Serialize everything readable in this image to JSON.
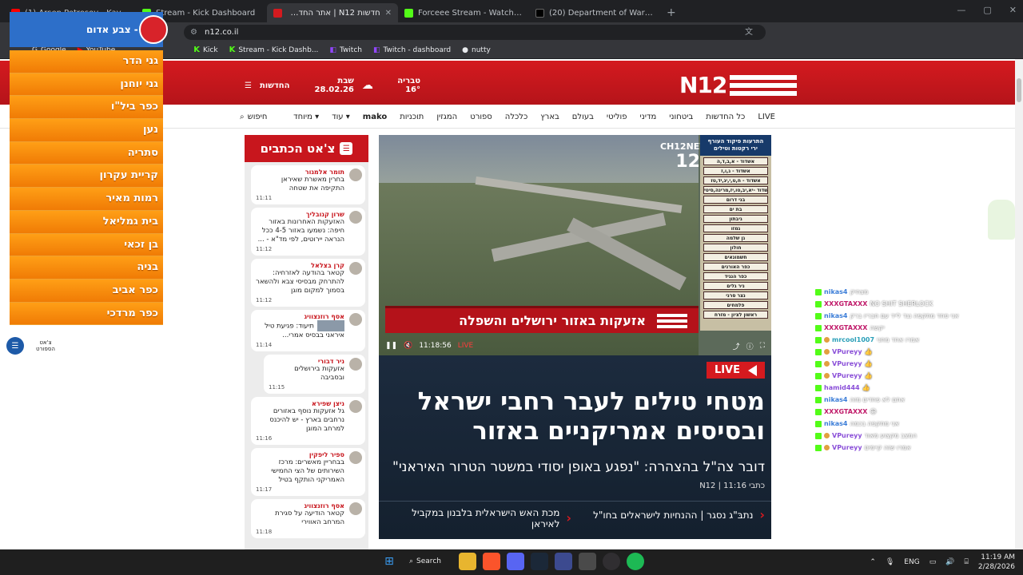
{
  "browser": {
    "tabs": [
      {
        "title": "(1) Arsen Petrosov - Kayfuem - YouTu",
        "color": "#ff0000",
        "active": false
      },
      {
        "title": "Stream - Kick Dashboard",
        "color": "#53fc18",
        "active": false
      },
      {
        "title": "חדשות N12 | אתר החדשות שו",
        "color": "#d41a1f",
        "active": true
      },
      {
        "title": "Forceee Stream - Watch Live on Kick",
        "color": "#53fc18",
        "active": false
      },
      {
        "title": "(20) Department of War us (@Deptof",
        "color": "#000000",
        "active": false
      }
    ],
    "url": "n12.co.il",
    "bookmarks": [
      {
        "label": "Google",
        "icon": "google-icon"
      },
      {
        "label": "YouTube",
        "icon": "youtube-icon"
      },
      {
        "label": "Kick",
        "icon": "kick-icon"
      },
      {
        "label": "Stream - Kick Dashb...",
        "icon": "kick-icon"
      },
      {
        "label": "Twitch",
        "icon": "twitch-icon"
      },
      {
        "label": "Twitch - dashboard",
        "icon": "twitch-icon"
      },
      {
        "label": "nutty",
        "icon": "nutty-icon"
      }
    ]
  },
  "n12": {
    "logo": "N12",
    "weather": "טבריה 16°",
    "date": "שבת 28.02.26",
    "news_link": "החדשות",
    "nav": [
      "LIVE",
      "כל החדשות",
      "ביטחוני",
      "מדיני",
      "פוליטי",
      "בעולם",
      "בארץ",
      "כלכלה",
      "ספורט",
      "המגזין",
      "תוכניות",
      "mako",
      "עוד",
      "מיוחד"
    ],
    "search_label": "חיפוש",
    "chat_title": "צ'אט הכתבים",
    "chat_messages": [
      {
        "author": "תומר אלמגור",
        "text": "בחרין מאשרת שאיראן התקיפה את שטחה",
        "time": "11:11"
      },
      {
        "author": "שרון קנובליך",
        "text": "האזעקות האחרונות באזור חיפה: נשמעו באזור 4-5 ככל הנראה יירוטים, לפי מד\"א - ...",
        "time": "11:12"
      },
      {
        "author": "קרן בצלאל",
        "text": "קטאר בהודעה לאזרחיה: להתרחק מבסיסי צבא ולהשאר בסמוך למקום מוגן",
        "time": "11:12"
      },
      {
        "author": "אסף רוזנצוויג",
        "text": "תיעוד: פגיעת טיל איראני בבסיס אמרי...",
        "time": "11:14"
      },
      {
        "author": "ניר דבורי",
        "text": "אזעקות בירושלים ובסביבה",
        "time": "11:15"
      },
      {
        "author": "ניצן שפירא",
        "text": "גל אזעקות נוסף באזורים נרחבים בארץ - יש להיכנס למרחב המוגן",
        "time": "11:16"
      },
      {
        "author": "ספיר ליפקין",
        "text": "בבחריין מאשרים: מרכז השירותים של הצי החמישי האמריקני הותקף בטיל",
        "time": "11:17"
      },
      {
        "author": "אסף רוזנצוויג",
        "text": "קטאר הודיעה על סגירת המרחב האווירי",
        "time": "11:18"
      }
    ],
    "video": {
      "channel": "CH12NEWS",
      "channel_num": "12",
      "banner": "אזעקות באזור ירושלים והשפלה",
      "timecode": "11:18:56",
      "live_label": "LIVE",
      "alerts_header": "התרעות פיקוד העורף",
      "alerts_sub": "ירי רקטות וטילים",
      "alerts": [
        "אשדוד - א,ב,ד,ה",
        "אשדוד - ג,ו,ז",
        "אשדוד - ח,ט,י,יג,יד,טז",
        "אשדוד -יא,יב,טו,יז,מרינה,סיטי",
        "בני דרום",
        "בת ים",
        "גיבתון",
        "גמזו",
        "גן שלמה",
        "חולון",
        "חשמונאים",
        "כפר האורנים",
        "כפר הנגיד",
        "ניר גלים",
        "נצר סרני",
        "פלמחים",
        "ראשון לציון - מזרח"
      ]
    },
    "headline": {
      "live_badge": "LIVE",
      "title": "מטחי טילים לעבר רחבי ישראל ובסיסים אמריקניים באזור",
      "subtitle": "דובר צה\"ל בהצהרה: \"נפגע באופן יסודי במשטר הטרור האיראני\"",
      "meta": "כתבי N12 | 11:16",
      "related": [
        "נתבּ\"ג נסגר | ההנחיות לישראלים בחו\"ל",
        "מכת האש הישראלית בלבנון במקביל לאיראן"
      ]
    }
  },
  "alert_widget": {
    "title": "צופר - צבע אדום",
    "towns": [
      "גני הדר",
      "גני יוחנן",
      "כפר ביל\"ו",
      "נען",
      "סתריה",
      "קריית עקרון",
      "רמות מאיר",
      "בית גמליאל",
      "בן זכאי",
      "בניה",
      "כפר אביב",
      "כפר מרדכי"
    ],
    "chat_label": "צ'אט הספורט"
  },
  "stream_chat": [
    {
      "user": "nikas4",
      "text": "מצחיק"
    },
    {
      "user": "XXXGTAXXX",
      "text": "NO SHIT SHERLOCK"
    },
    {
      "user": "nikas4",
      "text": "אני פחד מתקפה נגד לייד עם חבריו ברק"
    },
    {
      "user": "XXXGTAXXX",
      "text": "יקשה"
    },
    {
      "user": "mrcool1007",
      "text": "אמרו אחד מחני"
    },
    {
      "user": "VPureyy",
      "text": "👍"
    },
    {
      "user": "VPureyy",
      "text": "👍"
    },
    {
      "user": "VPureyy",
      "text": "👍"
    },
    {
      "user": "hamid444",
      "text": "👍"
    },
    {
      "user": "nikas4",
      "text": "אתם לא פחדים מזה"
    },
    {
      "user": "XXXGTAXXX",
      "text": "😀"
    },
    {
      "user": "nikas4",
      "text": "אני מתקפה בכמה"
    },
    {
      "user": "VPureyy",
      "text": "המצב מקצוע מאוד"
    },
    {
      "user": "VPureyy",
      "text": "אמרו שזה קיימים"
    }
  ],
  "taskbar": {
    "search_label": "Search",
    "lang": "ENG",
    "time": "11:19 AM",
    "date": "2/28/2026"
  },
  "colors": {
    "n12_red": "#d41a1f",
    "alert_orange": "#f07b05",
    "alert_blue": "#2d6fc9",
    "kick_green": "#53fc18"
  }
}
